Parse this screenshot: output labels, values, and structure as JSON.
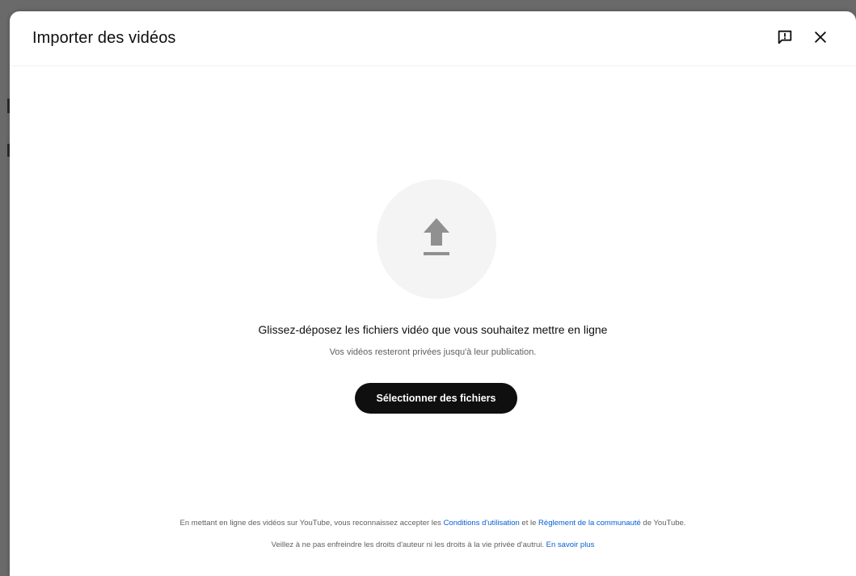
{
  "dialog": {
    "title": "Importer des vidéos"
  },
  "upload": {
    "drop_text": "Glissez-déposez les fichiers vidéo que vous souhaitez mettre en ligne",
    "sub_text": "Vos vidéos resteront privées jusqu'à leur publication.",
    "select_button_label": "Sélectionner des fichiers"
  },
  "footer": {
    "line1_before": "En mettant en ligne des vidéos sur YouTube, vous reconnaissez accepter les ",
    "terms_link": "Conditions d'utilisation",
    "line1_middle": " et le ",
    "community_link": "Règlement de la communauté",
    "line1_after": " de YouTube.",
    "line2_before": "Veillez à ne pas enfreindre les droits d'auteur ni les droits à la vie privée d'autrui. ",
    "learn_more_link": "En savoir plus"
  },
  "icons": {
    "feedback": "feedback-icon",
    "close": "close-icon",
    "upload": "upload-arrow-icon"
  },
  "colors": {
    "link": "#065fd4",
    "button_bg": "#0f0f0f",
    "upload_circle": "#f4f4f4",
    "upload_arrow": "#909090"
  }
}
